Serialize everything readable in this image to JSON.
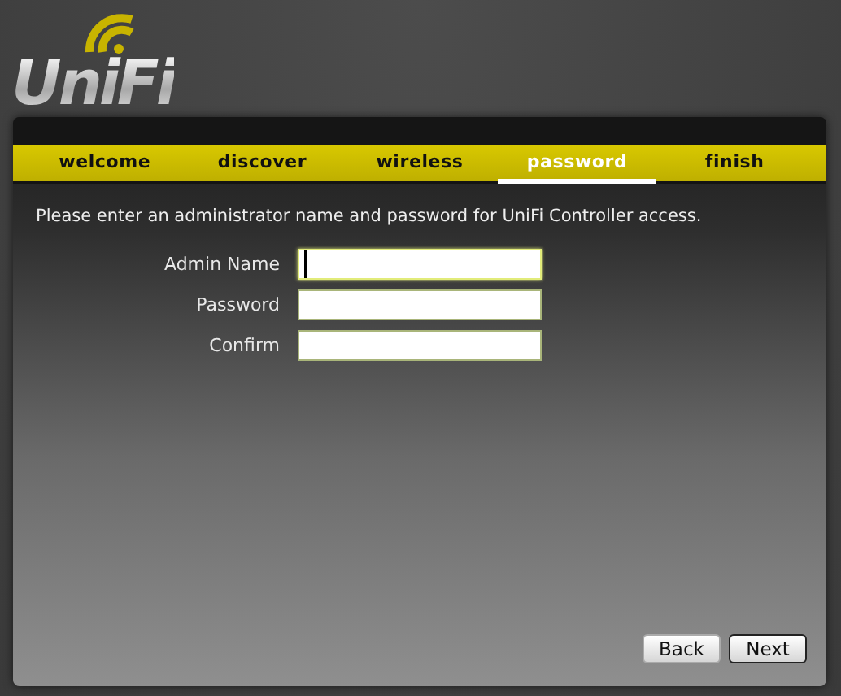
{
  "logo": {
    "text": "UniFi"
  },
  "tabs": [
    {
      "label": "welcome",
      "selected": false
    },
    {
      "label": "discover",
      "selected": false
    },
    {
      "label": "wireless",
      "selected": false
    },
    {
      "label": "password",
      "selected": true
    },
    {
      "label": "finish",
      "selected": false
    }
  ],
  "instructions": "Please enter an administrator name and password for UniFi Controller access.",
  "fields": [
    {
      "label": "Admin Name",
      "focused": true
    },
    {
      "label": "Password",
      "focused": false
    },
    {
      "label": "Confirm",
      "focused": false
    }
  ],
  "buttons": [
    {
      "label": "Back",
      "default": false
    },
    {
      "label": "Next",
      "default": true
    }
  ]
}
